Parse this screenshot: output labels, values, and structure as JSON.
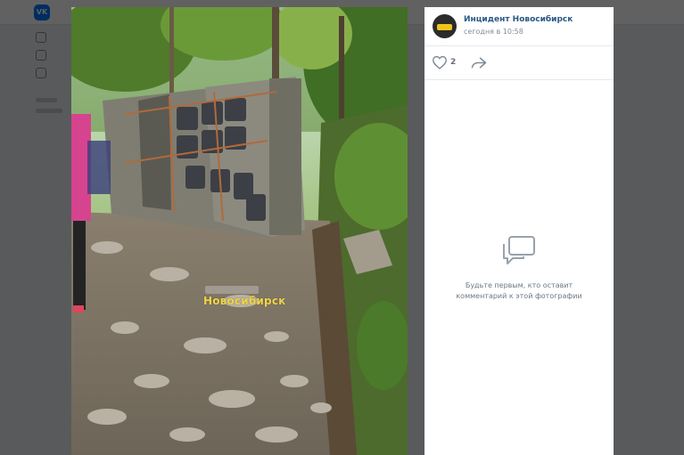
{
  "app": {
    "logo_text": "VK",
    "brand_color": "#0077ff"
  },
  "photo": {
    "watermark": "Новосибирск",
    "alt_subject": "overturned bus on rocky forest trail"
  },
  "post": {
    "author": "Инцидент Новосибирск",
    "time": "сегодня в 10:58",
    "likes": "2",
    "like_icon": "heart-icon",
    "share_icon": "share-arrow-icon"
  },
  "comments": {
    "empty_line1": "Будьте первым, кто оставит",
    "empty_line2": "комментарий к этой фотографии",
    "icon": "comment-bubble-icon"
  },
  "colors": {
    "link": "#2a5885",
    "secondary": "#818c99",
    "overlay": "rgba(0,0,0,0.62)"
  }
}
